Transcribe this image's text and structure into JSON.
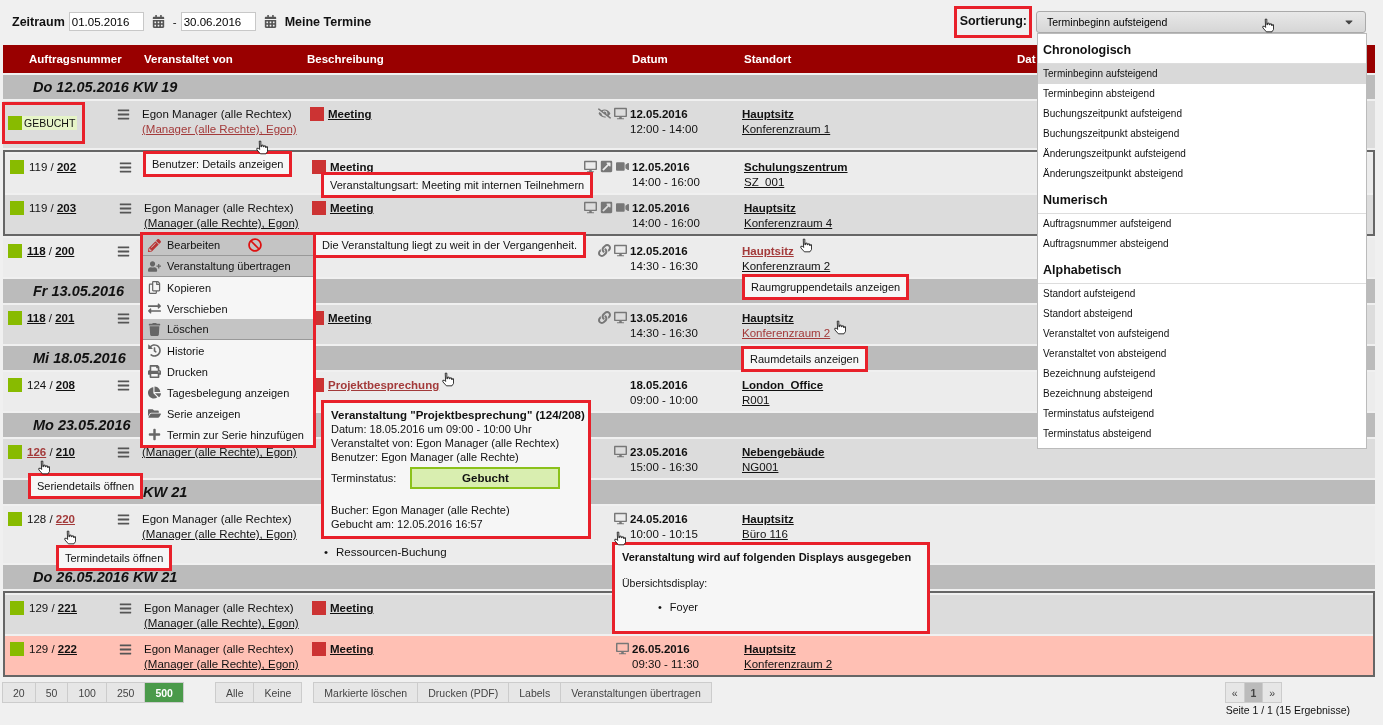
{
  "filter": {
    "label": "Zeitraum",
    "from": "01.05.2016",
    "separator": "-",
    "to": "30.06.2016",
    "mine": "Meine Termine"
  },
  "sort": {
    "label": "Sortierung:",
    "value": "Terminbeginn aufsteigend",
    "expanded": true,
    "groups": [
      {
        "heading": "Chronologisch",
        "options": [
          {
            "label": "Terminbeginn aufsteigend",
            "selected": true
          },
          {
            "label": "Terminbeginn absteigend",
            "selected": false
          },
          {
            "label": "Buchungszeitpunkt aufsteigend",
            "selected": false
          },
          {
            "label": "Buchungszeitpunkt absteigend",
            "selected": false
          },
          {
            "label": "Änderungszeitpunkt aufsteigend",
            "selected": false
          },
          {
            "label": "Änderungszeitpunkt absteigend",
            "selected": false
          }
        ]
      },
      {
        "heading": "Numerisch",
        "options": [
          {
            "label": "Auftragsnummer aufsteigend",
            "selected": false
          },
          {
            "label": "Auftragsnummer absteigend",
            "selected": false
          }
        ]
      },
      {
        "heading": "Alphabetisch",
        "options": [
          {
            "label": "Standort aufsteigend",
            "selected": false
          },
          {
            "label": "Standort absteigend",
            "selected": false
          },
          {
            "label": "Veranstaltet von aufsteigend",
            "selected": false
          },
          {
            "label": "Veranstaltet von absteigend",
            "selected": false
          },
          {
            "label": "Bezeichnung aufsteigend",
            "selected": false
          },
          {
            "label": "Bezeichnung absteigend",
            "selected": false
          },
          {
            "label": "Terminstatus aufsteigend",
            "selected": false
          },
          {
            "label": "Terminstatus absteigend",
            "selected": false
          }
        ]
      }
    ]
  },
  "table": {
    "columns": [
      "Auftragsnummer",
      "Veranstaltet von",
      "Beschreibung",
      "Datum",
      "Standort",
      "Dat"
    ],
    "items": [
      {
        "kind": "day",
        "label": "Do 12.05.2016 KW 19",
        "partial": false
      },
      {
        "kind": "row",
        "status_label": "GEBUCHT",
        "organizer": "Egon Manager (alle Rechtex)",
        "organizer_link": "(Manager (alle Rechte), Egon)",
        "organizer_link_hovered": true,
        "description": "Meeting",
        "icons": [
          {
            "kind": "hidden"
          },
          {
            "kind": "display"
          }
        ],
        "date": "12.05.2016",
        "time": "12:00 - 14:00",
        "site": "Hauptsitz",
        "room": "Konferenzraum 1",
        "highlighted": false
      },
      {
        "kind": "group",
        "rows": [
          {
            "kind": "row",
            "order": "119",
            "order_link": false,
            "separator": "/",
            "booking": "202",
            "description": "Meeting",
            "icons": [
              {
                "kind": "display"
              },
              {
                "kind": "share"
              },
              {
                "kind": "camera"
              }
            ],
            "date": "12.05.2016",
            "time": "14:00 - 16:00",
            "site": "Schulungszentrum",
            "room": "SZ_001",
            "highlighted": false
          },
          {
            "kind": "row",
            "order": "119",
            "order_link": false,
            "separator": "/",
            "booking": "203",
            "organizer": "Egon Manager (alle Rechtex)",
            "organizer_link": "(Manager (alle Rechte), Egon)",
            "description": "Meeting",
            "icons": [
              {
                "kind": "display"
              },
              {
                "kind": "share"
              },
              {
                "kind": "camera"
              }
            ],
            "date": "12.05.2016",
            "time": "14:00 - 16:00",
            "site": "Hauptsitz",
            "room": "Konferenzraum 4",
            "highlighted": false
          }
        ]
      },
      {
        "kind": "row",
        "order": "118",
        "order_link": true,
        "separator": "/",
        "booking": "200",
        "icons": [
          {
            "kind": "link"
          },
          {
            "kind": "display"
          }
        ],
        "date": "12.05.2016",
        "time": "14:30 - 16:30",
        "site": "Hauptsitz",
        "site_hovered": true,
        "room": "Konferenzraum 2",
        "highlighted": false
      },
      {
        "kind": "day",
        "label": "Fr 13.05.2016",
        "partial": false
      },
      {
        "kind": "row",
        "order": "118",
        "order_link": true,
        "separator": "/",
        "booking": "201",
        "description": "Meeting",
        "icons": [
          {
            "kind": "link"
          },
          {
            "kind": "display"
          }
        ],
        "date": "13.05.2016",
        "time": "14:30 - 16:30",
        "site": "Hauptsitz",
        "room": "Konferenzraum 2",
        "room_hovered": true,
        "highlighted": false
      },
      {
        "kind": "day",
        "label": "Mi 18.05.2016",
        "partial": false
      },
      {
        "kind": "row",
        "order": "124",
        "order_link": false,
        "separator": "/",
        "booking": "208",
        "description": "Projektbesprechung",
        "description_hovered": true,
        "date": "18.05.2016",
        "time": "09:00 - 10:00",
        "site": "London_Office",
        "room": "R001",
        "highlighted": false
      },
      {
        "kind": "day",
        "label": "Mo 23.05.2016",
        "partial": false
      },
      {
        "kind": "row",
        "order": "126",
        "order_link": true,
        "order_hovered": true,
        "separator": "/",
        "booking": "210",
        "organizer_link": "(Manager (alle Rechte), Egon)",
        "icons": [
          {
            "kind": "display"
          }
        ],
        "date": "23.05.2016",
        "time": "15:00 - 16:30",
        "site": "Nebengebäude",
        "room": "NG001",
        "highlighted": false
      },
      {
        "kind": "day",
        "label": "KW 21",
        "partial": true
      },
      {
        "kind": "row",
        "order": "128",
        "order_link": false,
        "separator": "/",
        "booking": "220",
        "booking_hovered": true,
        "organizer": "Egon Manager (alle Rechtex)",
        "organizer_link": "(Manager (alle Rechte), Egon)",
        "bullets": [
          {
            "marker": "•",
            "text": "Ressourcen-Buchung"
          }
        ],
        "icons": [
          {
            "kind": "display"
          }
        ],
        "date": "24.05.2016",
        "time": "10:00 - 10:15",
        "site": "Hauptsitz",
        "room": "Büro 116",
        "highlighted": false
      },
      {
        "kind": "day",
        "label": "Do 26.05.2016 KW 21",
        "partial": false
      },
      {
        "kind": "group",
        "rows": [
          {
            "kind": "row",
            "order": "129",
            "order_link": false,
            "separator": "/",
            "booking": "221",
            "organizer": "Egon Manager (alle Rechtex)",
            "organizer_link": "(Manager (alle Rechte), Egon)",
            "description": "Meeting",
            "highlighted": false
          },
          {
            "kind": "row",
            "order": "129",
            "order_link": false,
            "separator": "/",
            "booking": "222",
            "organizer": "Egon Manager (alle Rechtex)",
            "organizer_link": "(Manager (alle Rechte), Egon)",
            "description": "Meeting",
            "icons": [
              {
                "kind": "display"
              }
            ],
            "date": "26.05.2016",
            "time": "09:30 - 11:30",
            "site": "Hauptsitz",
            "room": "Konferenzraum 2",
            "highlighted": true
          }
        ]
      }
    ]
  },
  "context_menu": {
    "items": [
      {
        "kind": "edit",
        "label": "Bearbeiten",
        "highlighted": true,
        "blocked": true
      },
      {
        "kind": "transfer",
        "label": "Veranstaltung übertragen",
        "highlighted": true,
        "blocked": false
      },
      {
        "kind": "copy",
        "label": "Kopieren",
        "highlighted": false,
        "blocked": false
      },
      {
        "kind": "move",
        "label": "Verschieben",
        "highlighted": false,
        "blocked": false
      },
      {
        "kind": "delete",
        "label": "Löschen",
        "highlighted": true,
        "blocked": false
      },
      {
        "kind": "history",
        "label": "Historie",
        "highlighted": false,
        "blocked": false
      },
      {
        "kind": "print",
        "label": "Drucken",
        "highlighted": false,
        "blocked": false
      },
      {
        "kind": "occupancy",
        "label": "Tagesbelegung anzeigen",
        "highlighted": false,
        "blocked": false
      },
      {
        "kind": "series",
        "label": "Serie anzeigen",
        "highlighted": false,
        "blocked": false
      },
      {
        "kind": "add",
        "label": "Termin zur Serie hinzufügen",
        "highlighted": false,
        "blocked": false
      }
    ]
  },
  "hints": [
    {
      "kind": "user",
      "text": "Benutzer: Details anzeigen"
    },
    {
      "kind": "type",
      "text": "Veranstaltungsart: Meeting mit internen Teilnehmern"
    },
    {
      "kind": "past",
      "text": "Die Veranstaltung liegt zu weit in der Vergangenheit."
    },
    {
      "kind": "room_group",
      "text": "Raumgruppendetails anzeigen"
    },
    {
      "kind": "room",
      "text": "Raumdetails anzeigen"
    },
    {
      "kind": "series",
      "text": "Seriendetails öffnen"
    },
    {
      "kind": "appointment",
      "text": "Termindetails öffnen"
    }
  ],
  "event_popup": {
    "title": "Veranstaltung \"Projektbesprechung\" (124/208)",
    "lines": [
      "Datum: 18.05.2016 um 09:00 - 10:00 Uhr",
      "Veranstaltet von: Egon Manager (alle Rechtex)",
      "Benutzer: Egon Manager (alle Rechte)"
    ],
    "status_label": "Terminstatus:",
    "status": "Gebucht",
    "footer": [
      "Bucher: Egon Manager (alle Rechte)",
      "Gebucht am: 12.05.2016 16:57"
    ]
  },
  "display_popup": {
    "title": "Veranstaltung wird auf folgenden Displays ausgegeben",
    "subtitle": "Übersichtsdisplay:",
    "items": [
      {
        "marker": "•",
        "text": "Foyer"
      }
    ]
  },
  "footer": {
    "page_sizes": [
      {
        "label": "20",
        "selected": false
      },
      {
        "label": "50",
        "selected": false
      },
      {
        "label": "100",
        "selected": false
      },
      {
        "label": "250",
        "selected": false
      },
      {
        "label": "500",
        "selected": true
      }
    ],
    "selection": [
      "Alle",
      "Keine"
    ],
    "actions": [
      "Markierte löschen",
      "Drucken (PDF)",
      "Labels",
      "Veranstaltungen übertragen"
    ],
    "pager": {
      "prev": "«",
      "pages": [
        {
          "label": "1",
          "selected": true
        }
      ],
      "next": "»",
      "summary": "Seite 1 / 1 (15 Ergebnisse)"
    }
  }
}
